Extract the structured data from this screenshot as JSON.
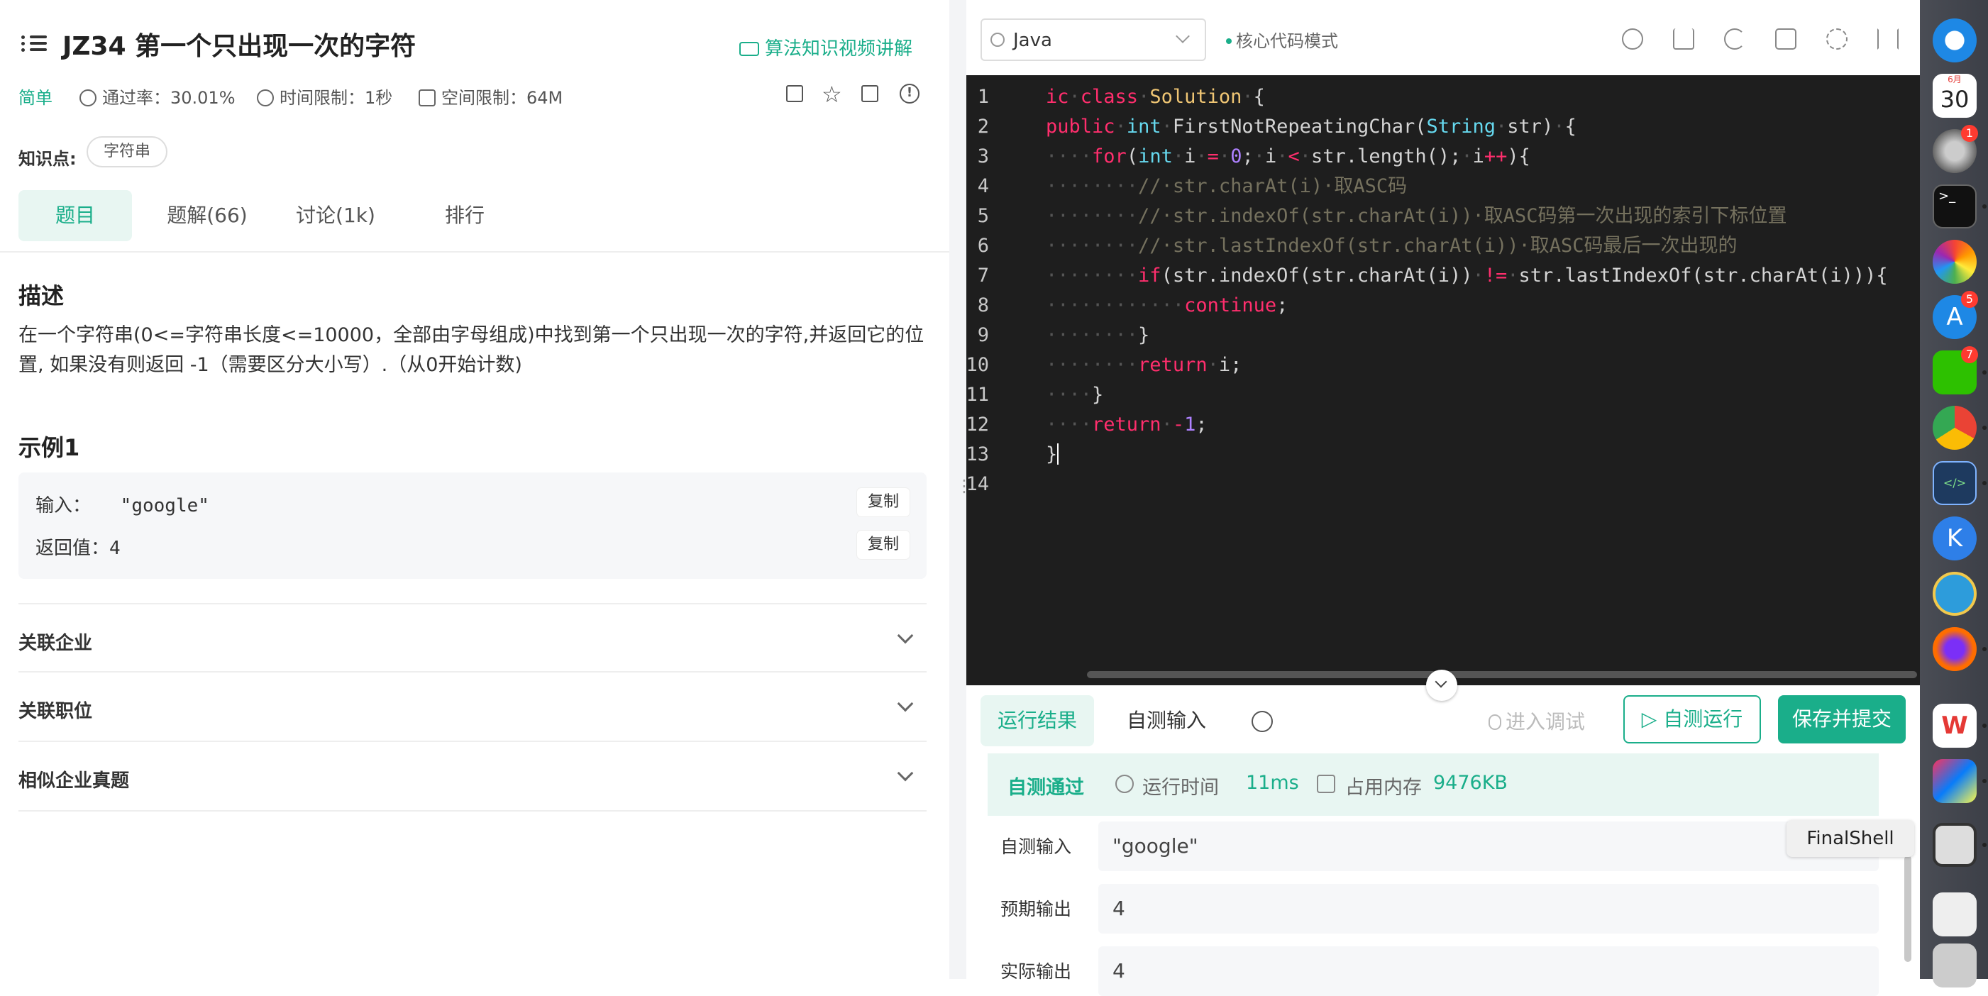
{
  "problem": {
    "title": "JZ34  第一个只出现一次的字符",
    "video_link": "算法知识视频讲解",
    "difficulty": "简单",
    "pass_rate": "通过率：30.01%",
    "time_limit": "时间限制：1秒",
    "space_limit": "空间限制：64M",
    "knowledge_label": "知识点:",
    "knowledge_tag": "字符串"
  },
  "tabs": [
    {
      "label": "题目"
    },
    {
      "label": "题解(66)"
    },
    {
      "label": "讨论(1k)"
    },
    {
      "label": "排行"
    }
  ],
  "description": {
    "heading": "描述",
    "text": "在一个字符串(0<=字符串长度<=10000，全部由字母组成)中找到第一个只出现一次的字符,并返回它的位置, 如果没有则返回 -1（需要区分大小写）.（从0开始计数)"
  },
  "example": {
    "heading": "示例1",
    "input_label": "输入：",
    "input_value": "\"google\"",
    "return_label": "返回值：",
    "return_value": "4",
    "copy_label": "复制"
  },
  "accordions": [
    {
      "label": "关联企业"
    },
    {
      "label": "关联职位"
    },
    {
      "label": "相似企业真题"
    }
  ],
  "editor": {
    "language": "Java",
    "mode": "核心代码模式",
    "line_numbers": [
      "1",
      "2",
      "3",
      "4",
      "5",
      "6",
      "7",
      "8",
      "9",
      "10",
      "11",
      "12",
      "13",
      "14"
    ]
  },
  "results": {
    "tab_run_result": "运行结果",
    "tab_custom_input": "自测输入",
    "debug_label": "进入调试",
    "self_run_label": "自测运行",
    "save_submit_label": "保存并提交",
    "status": "自测通过",
    "runtime_label": "运行时间",
    "runtime_value": "11ms",
    "memory_label": "占用内存",
    "memory_value": "9476KB",
    "custom_input_label": "自测输入",
    "custom_input_value": "\"google\"",
    "expected_label": "预期输出",
    "expected_value": "4",
    "actual_label": "实际输出",
    "actual_value": "4"
  },
  "dock": {
    "calendar_month": "6月",
    "calendar_day": "30",
    "settings_badge": "1",
    "appstore_badge": "5",
    "wechat_badge": "7",
    "tooltip": "FinalShell"
  },
  "colors": {
    "accent": "#1aae8a",
    "editor_bg": "#1e1e1e"
  }
}
